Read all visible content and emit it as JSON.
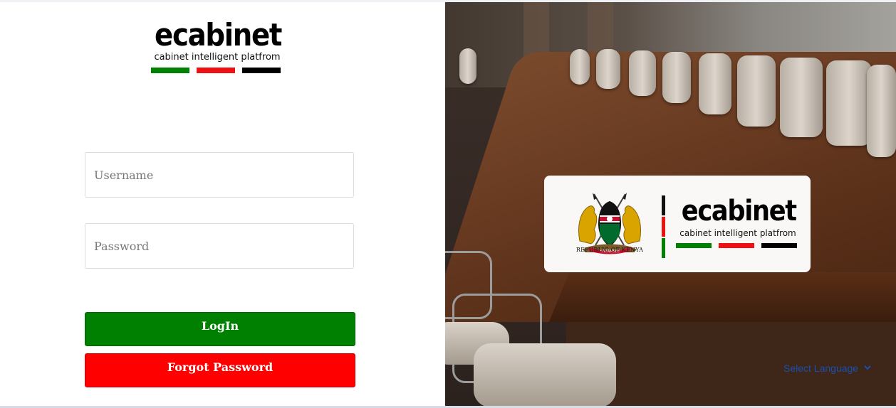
{
  "brand": {
    "title": "ecabinet",
    "subtitle": "cabinet intelligent platfrom"
  },
  "login_form": {
    "username_placeholder": "Username",
    "password_placeholder": "Password",
    "login_label": "LogIn",
    "forgot_label": "Forgot Password"
  },
  "card": {
    "emblem_caption": "REPUBLIC OF KENYA",
    "emblem_motto": "HARAMBEE",
    "title": "ecabinet",
    "subtitle": "cabinet intelligent platfrom"
  },
  "language": {
    "label": "Select Language"
  },
  "colors": {
    "green": "#008000",
    "red": "#ff0000",
    "black": "#000000"
  }
}
